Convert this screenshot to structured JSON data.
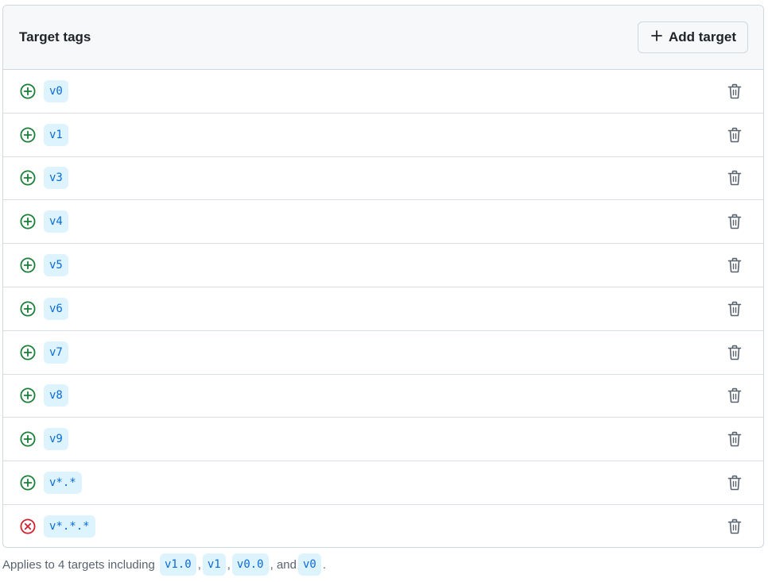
{
  "header": {
    "title": "Target tags",
    "add_button_label": "Add target"
  },
  "targets": [
    {
      "tag": "v0",
      "status": "included"
    },
    {
      "tag": "v1",
      "status": "included"
    },
    {
      "tag": "v3",
      "status": "included"
    },
    {
      "tag": "v4",
      "status": "included"
    },
    {
      "tag": "v5",
      "status": "included"
    },
    {
      "tag": "v6",
      "status": "included"
    },
    {
      "tag": "v7",
      "status": "included"
    },
    {
      "tag": "v8",
      "status": "included"
    },
    {
      "tag": "v9",
      "status": "included"
    },
    {
      "tag": "v*.*",
      "status": "included"
    },
    {
      "tag": "v*.*.*",
      "status": "excluded"
    }
  ],
  "footer": {
    "prefix": "Applies to 4 targets including",
    "examples": [
      "v1.0",
      "v1",
      "v0.0",
      "v0"
    ],
    "sep1": ",",
    "sep2": ",",
    "sep3": ", and",
    "end": "."
  },
  "colors": {
    "included": "#1a7f37",
    "excluded": "#cf222e",
    "tag_bg": "#ddf4ff",
    "tag_fg": "#0969da"
  },
  "icons": {
    "included": "plus-circle-icon",
    "excluded": "x-circle-icon",
    "delete": "trash-icon",
    "add": "plus-icon"
  }
}
